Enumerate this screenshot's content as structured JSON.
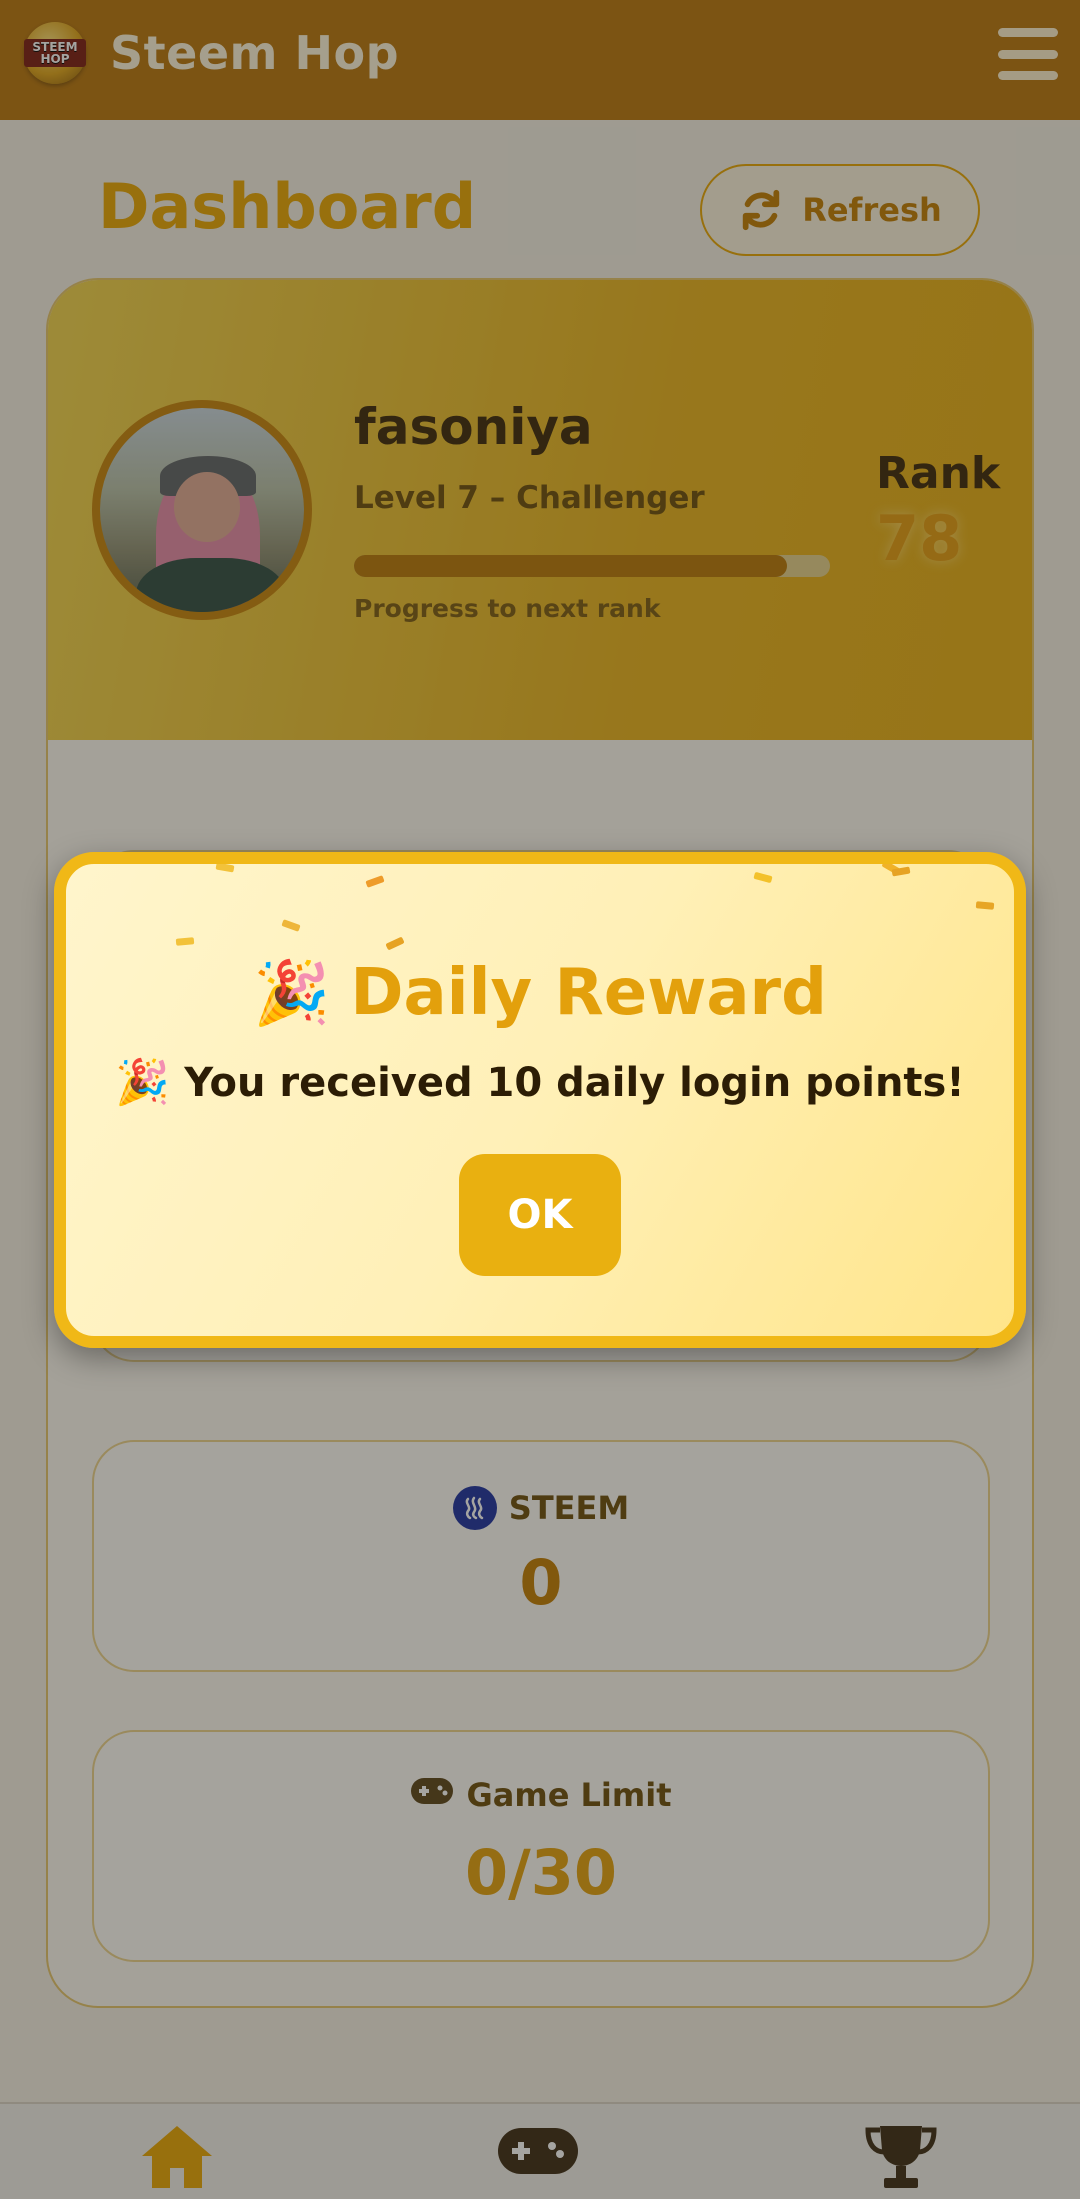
{
  "app": {
    "title": "Steem Hop",
    "logo_text": "STEEM HOP",
    "brand_color": "#b8750c",
    "accent_color": "#e8a500"
  },
  "header": {
    "menu_icon": "hamburger-menu-icon"
  },
  "dashboard": {
    "title": "Dashboard",
    "refresh_label": "Refresh",
    "refresh_icon": "refresh-icon"
  },
  "profile": {
    "username": "fasoniya",
    "level": "Level 7 – Challenger",
    "progress_fraction": 0.91,
    "progress_label": "Progress to next rank",
    "rank_label": "Rank",
    "rank_value": "78"
  },
  "stats": {
    "steem": {
      "label": "STEEM",
      "value": "0",
      "icon": "steem-icon",
      "value_color": "#c27d00"
    },
    "game_limit": {
      "label": "Game Limit",
      "value": "0/30",
      "icon": "gamepad-icon",
      "value_color": "#e3a00c"
    }
  },
  "bottom_nav": {
    "items": [
      {
        "name": "home",
        "icon": "home-icon",
        "color": "#e8a500"
      },
      {
        "name": "games",
        "icon": "gamepad-icon",
        "color": "#3b2a12"
      },
      {
        "name": "leaderboard",
        "icon": "trophy-icon",
        "color": "#3b2a12"
      }
    ]
  },
  "modal": {
    "title": "Daily Reward",
    "title_emoji": "🎉",
    "message": "You received 10 daily login points!",
    "message_emoji": "🎉",
    "ok_label": "OK"
  }
}
